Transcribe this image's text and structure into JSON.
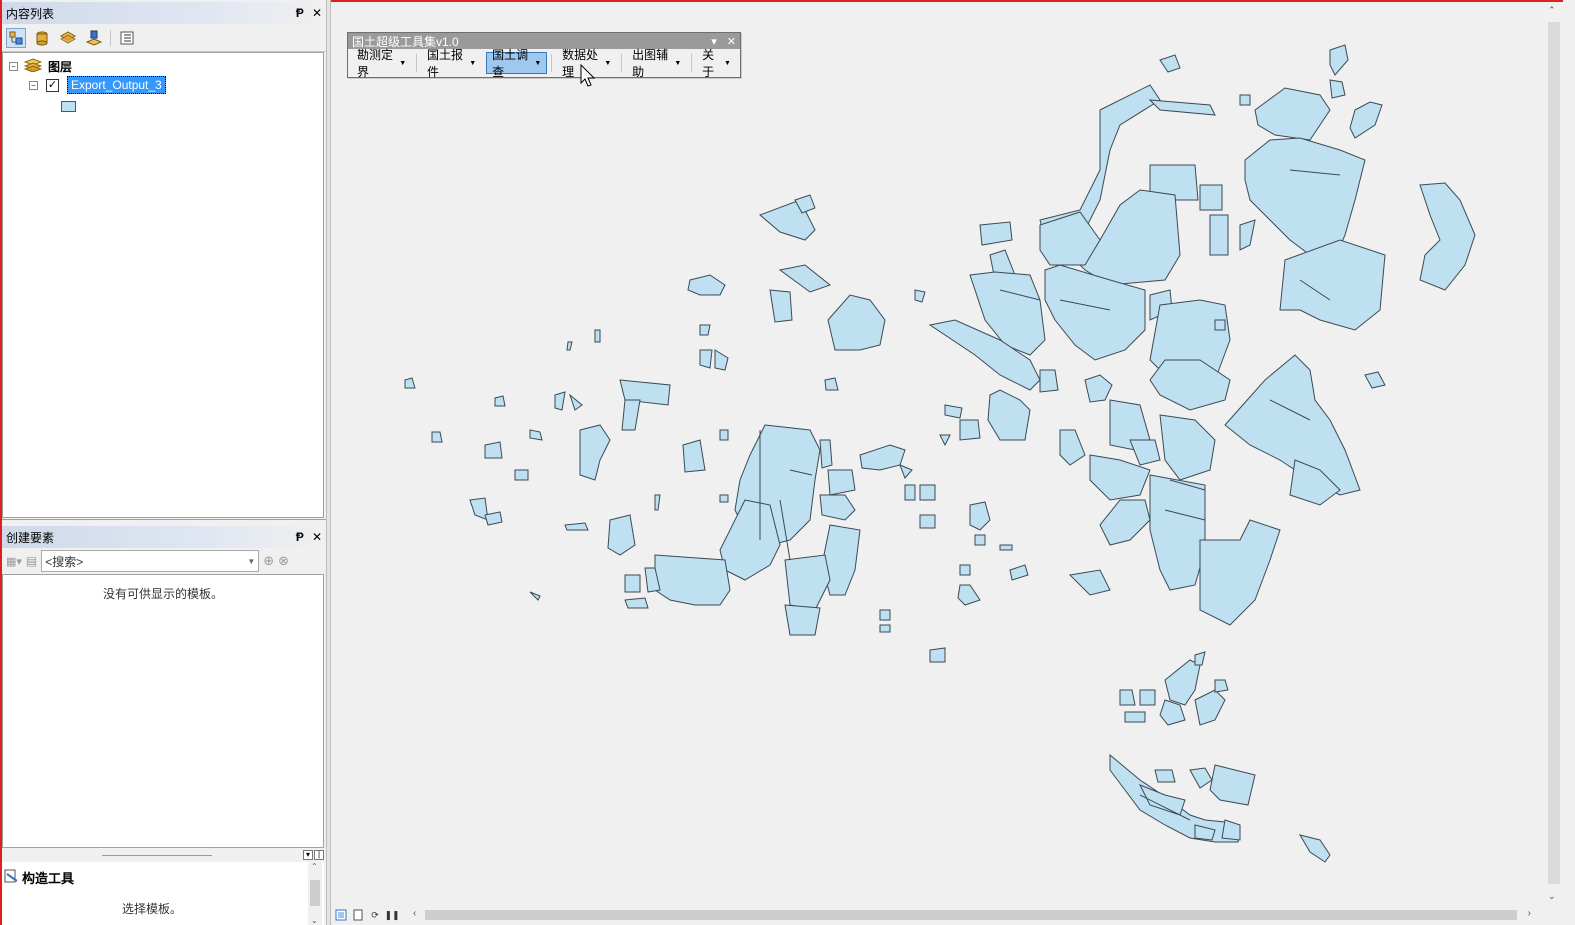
{
  "toc": {
    "title": "内容列表",
    "pin": "Ᵽ",
    "close": "✕",
    "group_label": "图层",
    "layer_label": "Export_Output_3",
    "layer_checked": "✓"
  },
  "create_features": {
    "title": "创建要素",
    "search_placeholder": "<搜索>",
    "empty_message": "没有可供显示的模板。"
  },
  "construct": {
    "title": "构造工具",
    "message": "选择模板。"
  },
  "floating_toolbar": {
    "title": "国土超级工具集v1.0",
    "menus": [
      {
        "label": "勘测定界",
        "active": false
      },
      {
        "label": "国土报件",
        "active": false
      },
      {
        "label": "国土调查",
        "active": true
      },
      {
        "label": "数据处理",
        "active": false
      },
      {
        "label": "出图辅助",
        "active": false
      },
      {
        "label": "关于",
        "active": false
      }
    ]
  },
  "map": {
    "feature_fill": "#bee0f0",
    "feature_stroke": "#3c4a55",
    "background": "#f0f0f0"
  },
  "colors": {
    "selection": "#3399ff",
    "active_menu": "#9ec8ee",
    "window_frame": "#e02020"
  }
}
